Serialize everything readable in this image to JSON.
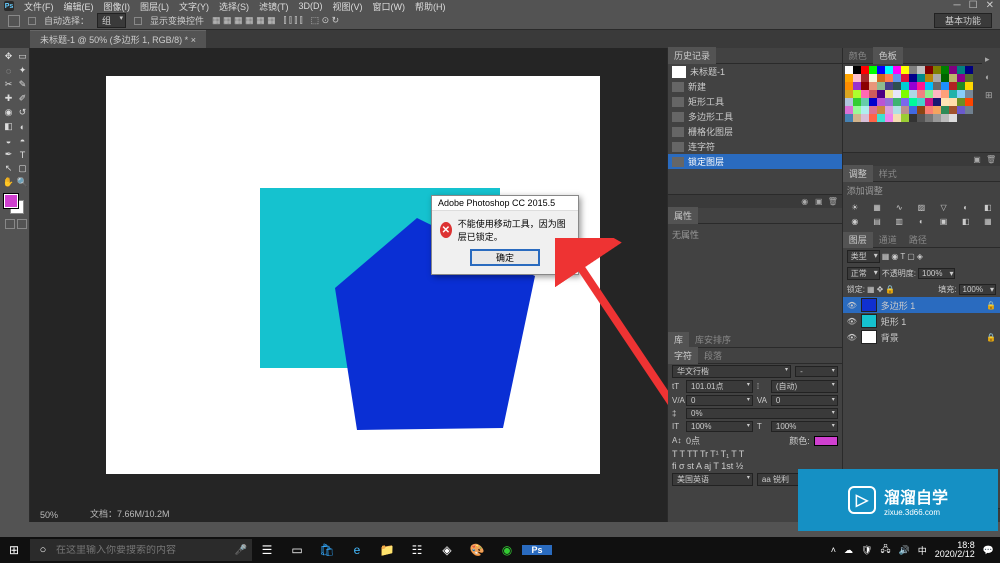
{
  "menubar": {
    "items": [
      "文件(F)",
      "编辑(E)",
      "图像(I)",
      "图层(L)",
      "文字(Y)",
      "选择(S)",
      "滤镜(T)",
      "3D(D)",
      "视图(V)",
      "窗口(W)",
      "帮助(H)"
    ]
  },
  "optbar": {
    "auto_select_label": "自动选择：",
    "auto_select_mode": "组",
    "transform_label": "显示变换控件",
    "workspace": "基本功能"
  },
  "document": {
    "tab_title": "未标题-1 @ 50% (多边形 1, RGB/8) *",
    "zoom": "50%",
    "file_size": "文档：7.66M/10.2M"
  },
  "dialog": {
    "title": "Adobe Photoshop CC 2015.5",
    "message": "不能使用移动工具，因为图层已锁定。",
    "ok": "确定"
  },
  "panels": {
    "history": {
      "title": "历史记录",
      "doc": "未标题-1",
      "items": [
        "新建",
        "矩形工具",
        "多边形工具",
        "栅格化图层",
        "连字符",
        "锁定图层"
      ]
    },
    "swatches": {
      "tab1": "颜色",
      "tab2": "色板"
    },
    "properties": {
      "title": "属性",
      "none": "无属性"
    },
    "adjustments": {
      "tab1": "调整",
      "tab2": "样式",
      "add_text": "添加调整"
    },
    "libraries": {
      "tab1": "库",
      "tab2": "库安排序"
    },
    "layers": {
      "tab1": "图层",
      "tab2": "通道",
      "tab3": "路径",
      "kind": "类型",
      "mode": "正常",
      "opacity_label": "不透明度:",
      "opacity": "100%",
      "lock_label": "锁定:",
      "fill_label": "填充:",
      "fill": "100%",
      "items": [
        {
          "name": "多边形 1",
          "selected": true,
          "visible": true,
          "locked": true,
          "color": "#1030d0"
        },
        {
          "name": "矩形 1",
          "selected": false,
          "visible": true,
          "locked": false,
          "color": "#15c2cf"
        },
        {
          "name": "背景",
          "selected": false,
          "visible": true,
          "locked": true,
          "color": "#fff"
        }
      ]
    },
    "character": {
      "tab1": "字符",
      "tab2": "段落",
      "font": "华文行楷",
      "size": "101.01点",
      "leading": "(自动)",
      "tracking_va": "VA",
      "tracking": "0",
      "scale": "0%",
      "color_label": "颜色:",
      "height": "100%",
      "width": "100%",
      "lang": "美国英语",
      "aa": "aa  锐利"
    }
  },
  "swatch_colors": [
    "#fff",
    "#000",
    "#f00",
    "#0f0",
    "#00f",
    "#0ff",
    "#f0f",
    "#ff0",
    "#808080",
    "#c0c0c0",
    "#800000",
    "#808000",
    "#008000",
    "#800080",
    "#008080",
    "#000080",
    "#ffa500",
    "#ffc0cb",
    "#a52a2a",
    "#f5f5dc",
    "#d2691e",
    "#ff7f50",
    "#6495ed",
    "#dc143c",
    "#00008b",
    "#008b8b",
    "#b8860b",
    "#a9a9a9",
    "#006400",
    "#bdb76b",
    "#8b008b",
    "#556b2f",
    "#ff8c00",
    "#9932cc",
    "#8b0000",
    "#e9967a",
    "#8fbc8f",
    "#483d8b",
    "#2f4f4f",
    "#00ced1",
    "#9400d3",
    "#ff1493",
    "#00bfff",
    "#696969",
    "#1e90ff",
    "#b22222",
    "#228b22",
    "#ffd700",
    "#daa520",
    "#adff2f",
    "#ff69b4",
    "#cd5c5c",
    "#4b0082",
    "#f0e68c",
    "#e6e6fa",
    "#7cfc00",
    "#add8e6",
    "#f08080",
    "#90ee90",
    "#ffb6c1",
    "#ffa07a",
    "#20b2aa",
    "#87cefa",
    "#778899",
    "#b0c4de",
    "#32cd32",
    "#66cdaa",
    "#0000cd",
    "#ba55d3",
    "#9370db",
    "#3cb371",
    "#7b68ee",
    "#00fa9a",
    "#48d1cc",
    "#c71585",
    "#191970",
    "#ffe4b5",
    "#ffdead",
    "#6b8e23",
    "#ff4500",
    "#da70d6",
    "#98fb98",
    "#afeeee",
    "#db7093",
    "#cd853f",
    "#dda0dd",
    "#b0e0e6",
    "#bc8f8f",
    "#4169e1",
    "#8b4513",
    "#fa8072",
    "#f4a460",
    "#2e8b57",
    "#a0522d",
    "#6a5acd",
    "#708090",
    "#4682b4",
    "#d2b48c",
    "#d8bfd8",
    "#ff6347",
    "#40e0d0",
    "#ee82ee",
    "#f5deb3",
    "#9acd32",
    "#333",
    "#555",
    "#777",
    "#999",
    "#bbb",
    "#ddd"
  ],
  "taskbar": {
    "search_placeholder": "在这里输入你要搜索的内容",
    "time": "18:8",
    "date": "2020/2/12"
  },
  "watermark": {
    "brand": "溜溜自学",
    "url": "zixue.3d66.com"
  }
}
